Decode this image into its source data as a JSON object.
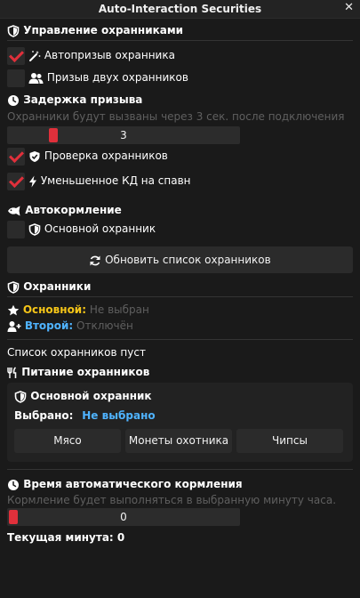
{
  "window": {
    "title": "Auto-Interaction Securities",
    "close_glyph": "✕"
  },
  "guards_management": {
    "header": "Управление охранниками",
    "auto_summon": {
      "label": "Автопризыв охранника",
      "checked": true
    },
    "summon_two": {
      "label": "Призыв двух охранников",
      "checked": false
    }
  },
  "summon_delay": {
    "header": "Задержка призыва",
    "hint": "Охранники будут вызваны через 3 сек. после подключения",
    "value": "3",
    "fraction": 0.18
  },
  "check_guards": {
    "label": "Проверка охранников",
    "checked": true
  },
  "reduced_cd": {
    "label": "Уменьшенное КД на спавн",
    "checked": true
  },
  "auto_feed": {
    "header": "Автокормление",
    "main_guard": {
      "label": "Основной охранник",
      "checked": false
    }
  },
  "refresh_button": {
    "label": "Обновить список охранников"
  },
  "guards": {
    "header": "Охранники",
    "primary_label": "Основной:",
    "primary_value": "Не выбран",
    "secondary_label": "Второй:",
    "secondary_value": "Отключён"
  },
  "list_empty": "Список охранников пуст",
  "feeding": {
    "header": "Питание охранников",
    "panel_title": "Основной охранник",
    "selected_label": "Выбрано:",
    "selected_value": "Не выбрано",
    "options": [
      "Мясо",
      "Монеты охотника",
      "Чипсы"
    ]
  },
  "auto_feed_time": {
    "header": "Время автоматического кормления",
    "hint": "Кормление будет выполняться в выбранную минуту часа.",
    "value": "0",
    "fraction": 0.0
  },
  "current_minute": "Текущая минута: 0",
  "colors": {
    "accent": "#e0303b",
    "gold": "#f5c518",
    "blue": "#4fb3ff",
    "background": "#1a1a1a"
  },
  "icons": [
    "shield-icon",
    "magic-wand-icon",
    "users-icon",
    "clock-icon",
    "shield-check-icon",
    "bolt-icon",
    "fish-icon",
    "refresh-icon",
    "star-icon",
    "user-plus-icon",
    "utensils-icon",
    "close-icon"
  ]
}
